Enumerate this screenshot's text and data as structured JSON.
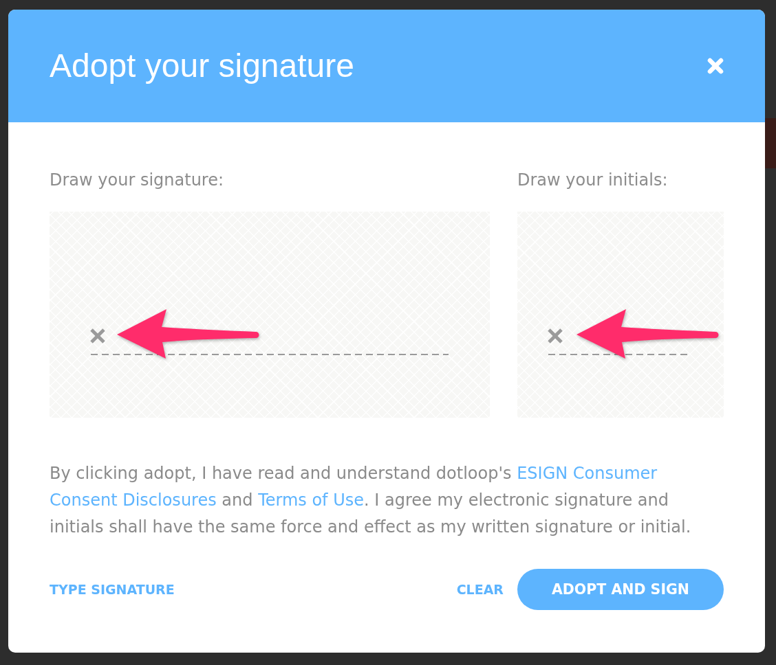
{
  "dialog": {
    "title": "Adopt your signature"
  },
  "pads": [
    {
      "kind": "signature",
      "label": "Draw your signature:"
    },
    {
      "kind": "initials",
      "label": "Draw your initials:"
    }
  ],
  "consent": [
    {
      "kind": "text",
      "text": "By clicking adopt, I have read and understand dotloop's "
    },
    {
      "kind": "link",
      "parts": [
        "ESIGN Consumer",
        "Consent Disclosures"
      ]
    },
    {
      "kind": "text",
      "text": " and "
    },
    {
      "kind": "link",
      "parts": [
        "Terms of Use"
      ]
    },
    {
      "kind": "text",
      "text": ". I agree my electronic signature and initials shall have the same force and effect as my written signature or initial."
    }
  ],
  "footer": {
    "type_signature": "TYPE SIGNATURE",
    "clear": "CLEAR",
    "adopt": "ADOPT AND SIGN"
  }
}
